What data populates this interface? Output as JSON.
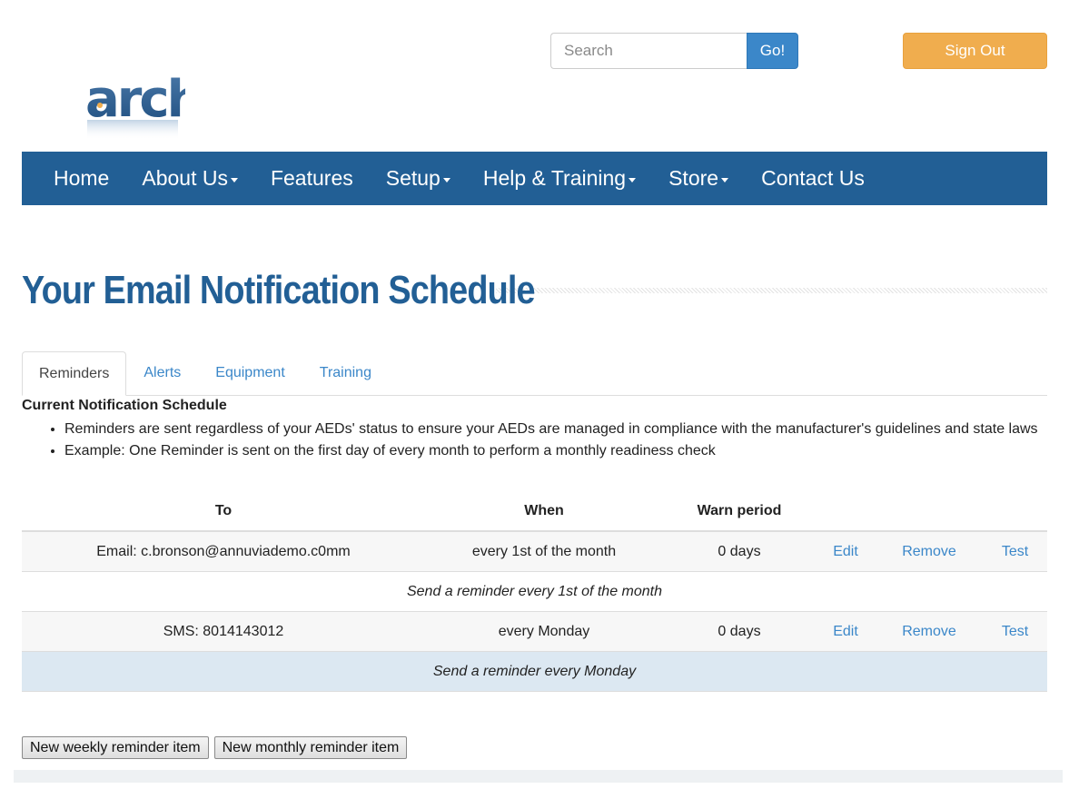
{
  "header": {
    "logo_text": "arch",
    "search_placeholder": "Search",
    "search_button": "Go!",
    "signout_button": "Sign Out"
  },
  "nav": {
    "items": [
      {
        "label": "Home",
        "dropdown": false
      },
      {
        "label": "About Us",
        "dropdown": true
      },
      {
        "label": "Features",
        "dropdown": false
      },
      {
        "label": "Setup",
        "dropdown": true
      },
      {
        "label": "Help & Training",
        "dropdown": true
      },
      {
        "label": "Store",
        "dropdown": true
      },
      {
        "label": "Contact Us",
        "dropdown": false
      }
    ]
  },
  "page": {
    "title": "Your Email Notification Schedule"
  },
  "tabs": [
    {
      "label": "Reminders",
      "active": true
    },
    {
      "label": "Alerts",
      "active": false
    },
    {
      "label": "Equipment",
      "active": false
    },
    {
      "label": "Training",
      "active": false
    }
  ],
  "schedule": {
    "heading": "Current Notification Schedule",
    "bullets": [
      "Reminders are sent regardless of your AEDs' status to ensure your AEDs are managed in compliance with the manufacturer's guidelines and state laws",
      "Example: One Reminder is sent on the first day of every month to perform a monthly readiness check"
    ]
  },
  "table": {
    "headers": {
      "to": "To",
      "when": "When",
      "warn": "Warn period"
    },
    "rows": [
      {
        "to": "Email: c.bronson@annuviademo.c0mm",
        "when": "every 1st of the month",
        "warn": "0 days",
        "edit": "Edit",
        "remove": "Remove",
        "test": "Test",
        "description": "Send a reminder every 1st of the month"
      },
      {
        "to": "SMS: 8014143012",
        "when": "every Monday",
        "warn": "0 days",
        "edit": "Edit",
        "remove": "Remove",
        "test": "Test",
        "description": "Send a reminder every Monday"
      }
    ]
  },
  "buttons": {
    "new_weekly": "New weekly reminder item",
    "new_monthly": "New monthly reminder item"
  },
  "colors": {
    "brand_blue": "#225f95",
    "link_blue": "#3b87c9",
    "signout_orange": "#f0ad4e",
    "highlight_row": "#dce8f2"
  }
}
